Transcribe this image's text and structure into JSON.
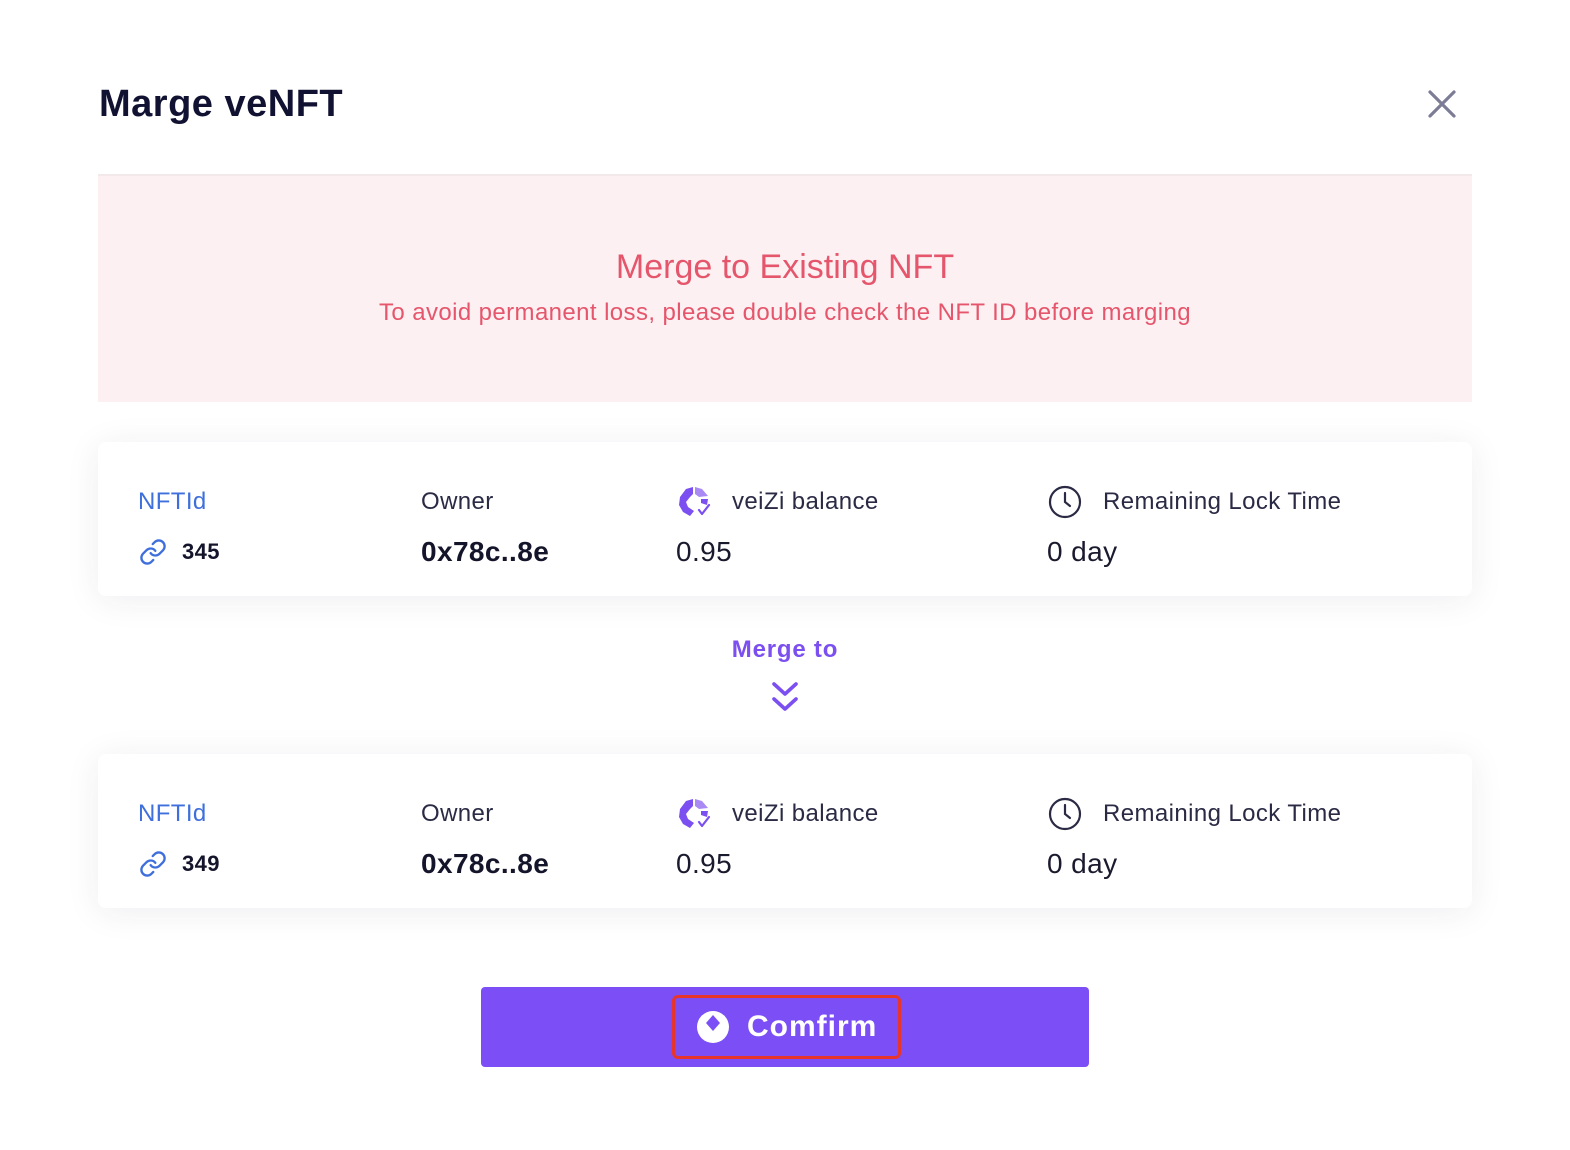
{
  "modal": {
    "title": "Marge veNFT",
    "close_icon": "close-icon"
  },
  "warning": {
    "title": "Merge to Existing NFT",
    "text": "To avoid permanent loss, please double check the NFT ID before marging"
  },
  "source_nft": {
    "nftid_label": "NFTId",
    "nftid_value": "345",
    "owner_label": "Owner",
    "owner_value": "0x78c..8e",
    "balance_label": "veiZi balance",
    "balance_value": "0.95",
    "lock_label": "Remaining Lock Time",
    "lock_value": "0 day"
  },
  "merge_to_label": "Merge to",
  "target_nft": {
    "nftid_label": "NFTId",
    "nftid_value": "349",
    "owner_label": "Owner",
    "owner_value": "0x78c..8e",
    "balance_label": "veiZi balance",
    "balance_value": "0.95",
    "lock_label": "Remaining Lock Time",
    "lock_value": "0 day"
  },
  "confirm_button": {
    "label": "Comfirm"
  },
  "colors": {
    "accent": "#7b4ff5",
    "warning": "#e5566c",
    "warning_bg": "#fcf0f2",
    "link": "#3e6fdc",
    "highlight": "#e8352c"
  }
}
